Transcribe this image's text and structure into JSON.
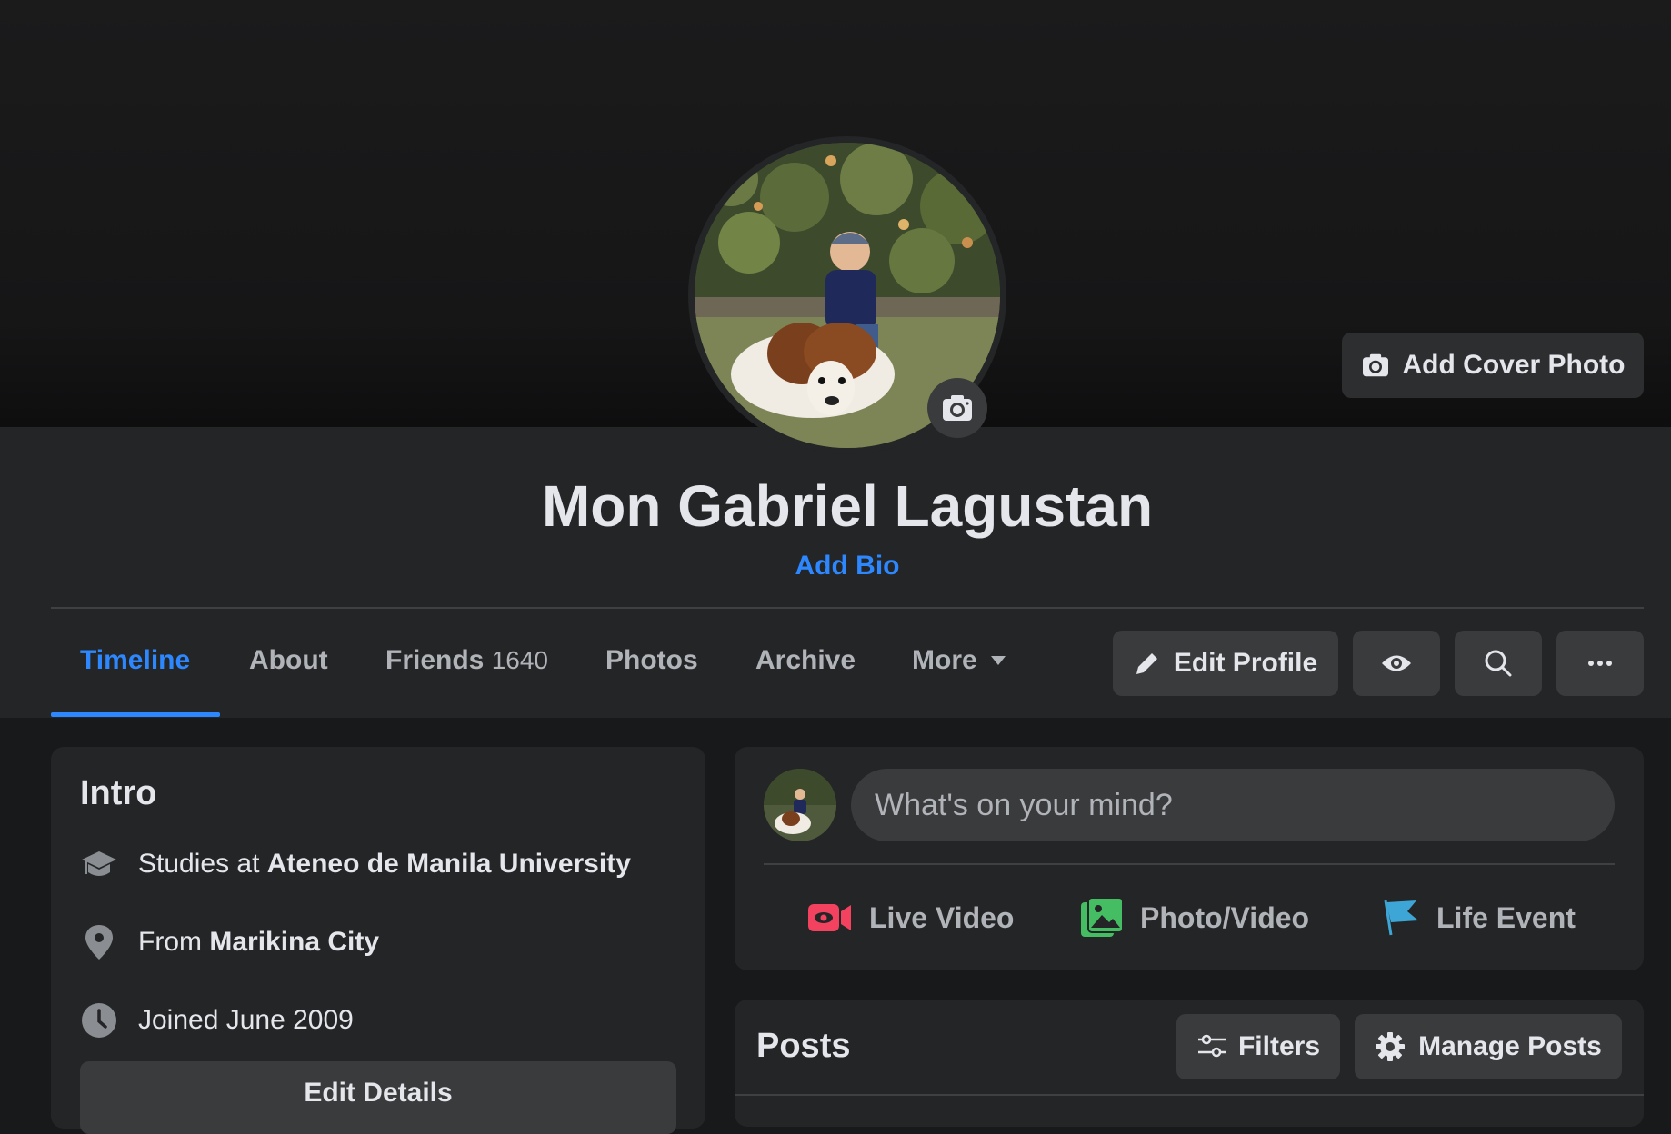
{
  "profile": {
    "name": "Mon Gabriel Lagustan",
    "bio_link": "Add Bio",
    "add_cover_label": "Add Cover Photo"
  },
  "tabs": [
    {
      "label": "Timeline",
      "active": true
    },
    {
      "label": "About"
    },
    {
      "label": "Friends",
      "count": "1640"
    },
    {
      "label": "Photos"
    },
    {
      "label": "Archive"
    },
    {
      "label": "More"
    }
  ],
  "actions": {
    "edit_profile": "Edit Profile",
    "view_as_icon": "eye-icon",
    "search_icon": "search-icon",
    "more_icon": "more-dots-icon"
  },
  "intro": {
    "title": "Intro",
    "studies_prefix": "Studies at",
    "studies_value": "Ateneo de Manila University",
    "from_prefix": "From",
    "from_value": "Marikina City",
    "joined": "Joined June 2009",
    "edit_details": "Edit Details"
  },
  "composer": {
    "placeholder": "What's on your mind?",
    "live_video": "Live Video",
    "photo_video": "Photo/Video",
    "life_event": "Life Event"
  },
  "posts": {
    "title": "Posts",
    "filters": "Filters",
    "manage": "Manage Posts"
  },
  "colors": {
    "accent": "#2d88ff",
    "live_red": "#f3425f",
    "photo_green": "#45bd62",
    "event_blue": "#3ea6d6"
  }
}
